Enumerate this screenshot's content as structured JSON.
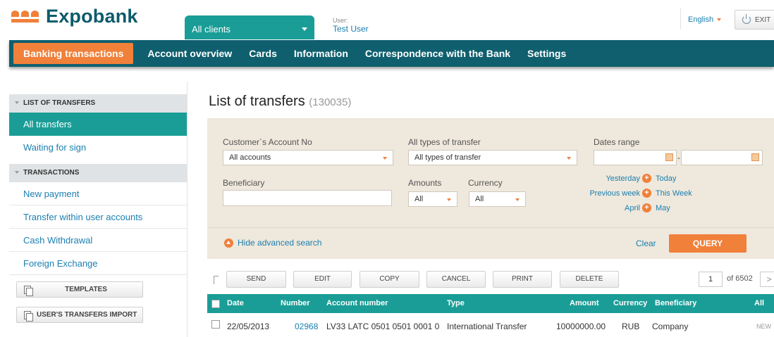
{
  "header": {
    "brand": "Expobank",
    "client_selector": "All clients",
    "user_label": "User:",
    "user_name": "Test User",
    "language": "English",
    "exit_label": "EXIT"
  },
  "nav": [
    "Banking transactions",
    "Account overview",
    "Cards",
    "Information",
    "Correspondence with the Bank",
    "Settings"
  ],
  "sidebar": {
    "section1": "LIST OF TRANSFERS",
    "items1": [
      "All transfers",
      "Waiting for sign"
    ],
    "section2": "TRANSACTIONS",
    "items2": [
      "New payment",
      "Transfer within user accounts",
      "Cash Withdrawal",
      "Foreign Exchange"
    ],
    "templates_button": "TEMPLATES",
    "import_button": "USER'S TRANSFERS IMPORT"
  },
  "page": {
    "title": "List of transfers",
    "count": "(130035)"
  },
  "filter": {
    "account_label": "Customer`s Account No",
    "account_value": "All accounts",
    "type_label": "All types of transfer",
    "type_value": "All types of transfer",
    "dates_label": "Dates range",
    "date_separator": "-",
    "beneficiary_label": "Beneficiary",
    "amounts_label": "Amounts",
    "amounts_value": "All",
    "currency_label": "Currency",
    "currency_value": "All",
    "quick": [
      [
        "Yesterday",
        "Today"
      ],
      [
        "Previous week",
        "This Week"
      ],
      [
        "April",
        "May"
      ]
    ],
    "hide_advanced": "Hide advanced search",
    "clear": "Clear",
    "query": "QUERY"
  },
  "toolbar": {
    "buttons": [
      "SEND",
      "EDIT",
      "COPY",
      "CANCEL",
      "PRINT",
      "DELETE"
    ],
    "page": "1",
    "of": "of 6502",
    "next": ">"
  },
  "table": {
    "headers": [
      "Date",
      "Number",
      "Account number",
      "Type",
      "Amount",
      "Currency",
      "Beneficiary",
      "All"
    ],
    "rows": [
      {
        "date": "22/05/2013",
        "number": "02968",
        "account": "LV33 LATC 0501 0501 0001 0",
        "type": "International Transfer",
        "amount": "10000000.00",
        "currency": "RUB",
        "beneficiary": "Company",
        "status": "NEW"
      }
    ]
  },
  "colors": {
    "teal": "#1a9d96",
    "navy": "#0f5f6e",
    "orange": "#f0803a"
  }
}
